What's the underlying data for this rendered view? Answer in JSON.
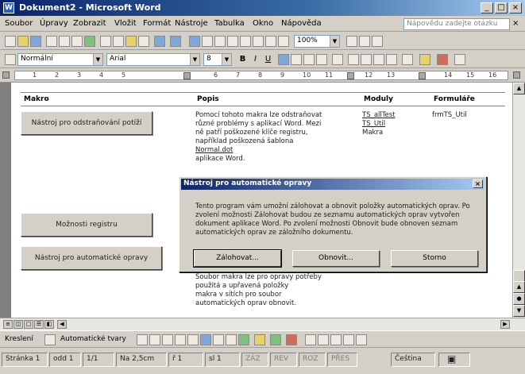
{
  "window": {
    "app_icon_letter": "W",
    "title": "Dokument2 - Microsoft Word",
    "buttons": [
      "_",
      "□",
      "×"
    ]
  },
  "menu": {
    "items": [
      "Soubor",
      "Úpravy",
      "Zobrazit",
      "Vložit",
      "Formát",
      "Nástroje",
      "Tabulka",
      "Okno",
      "Nápověda"
    ],
    "help_placeholder": "Nápovědu zadejte otázku",
    "close": "×"
  },
  "toolbar": {
    "zoom": "100%",
    "style": "Normální",
    "font": "Arial",
    "size": "8",
    "bold": "B",
    "italic": "I",
    "underline": "U"
  },
  "ruler": {
    "numbers": [
      "1",
      "2",
      "3",
      "4",
      "5",
      "6",
      "7",
      "8",
      "9",
      "10",
      "11",
      "12",
      "13",
      "14",
      "15",
      "16"
    ]
  },
  "table": {
    "headers": [
      "Makro",
      "Popis",
      "Moduly",
      "Formuláře"
    ],
    "row1": {
      "macro": "Nástroj pro odstraňování potíží",
      "description": [
        "Pomocí tohoto makra lze odstraňovat",
        "různé problémy s aplikací Word. Mezi",
        "ně patří poškozené klíče registru,",
        "například poškozená šablona",
        "",
        "aplikace Word."
      ],
      "normal_dot": "Normal.dot",
      "modules": [
        "TS_allTest",
        "TS_Util",
        "Makra"
      ],
      "forms": "frmTS_Util"
    },
    "row2": {
      "macro": "Možnosti registru"
    },
    "row3": {
      "macro": "Nástroj pro automatické opravy",
      "description": [
        "Soubor makra lze pro opravy potřeby",
        "použitá a upřavená položky",
        "makra v sítích pro soubor",
        "automatických oprav obnovit."
      ]
    }
  },
  "dialog": {
    "title": "Nástroj pro automatické opravy",
    "close": "×",
    "text": "Tento program vám umožní zálohovat a obnovit položky automatických oprav. Po zvolení možnosti Zálohovat budou ze seznamu automatických oprav vytvořen dokument aplikace Word. Po zvolení možnosti Obnovit bude obnoven seznam automatických oprav ze záložního dokumentu.",
    "buttons": {
      "backup": "Zálohovat...",
      "restore": "Obnovit...",
      "cancel": "Storno"
    }
  },
  "drawing_toolbar": {
    "draw": "Kreslení",
    "autoshapes": "Automatické tvary"
  },
  "status": {
    "page": "Stránka 1",
    "section": "odd 1",
    "pages": "1/1",
    "position": "Na 2,5cm",
    "line": "ř 1",
    "col": "sl 1",
    "rec": "ZÁZ",
    "trk": "REV",
    "ext": "ROZ",
    "ovr": "PŘES",
    "language": "Čeština"
  }
}
